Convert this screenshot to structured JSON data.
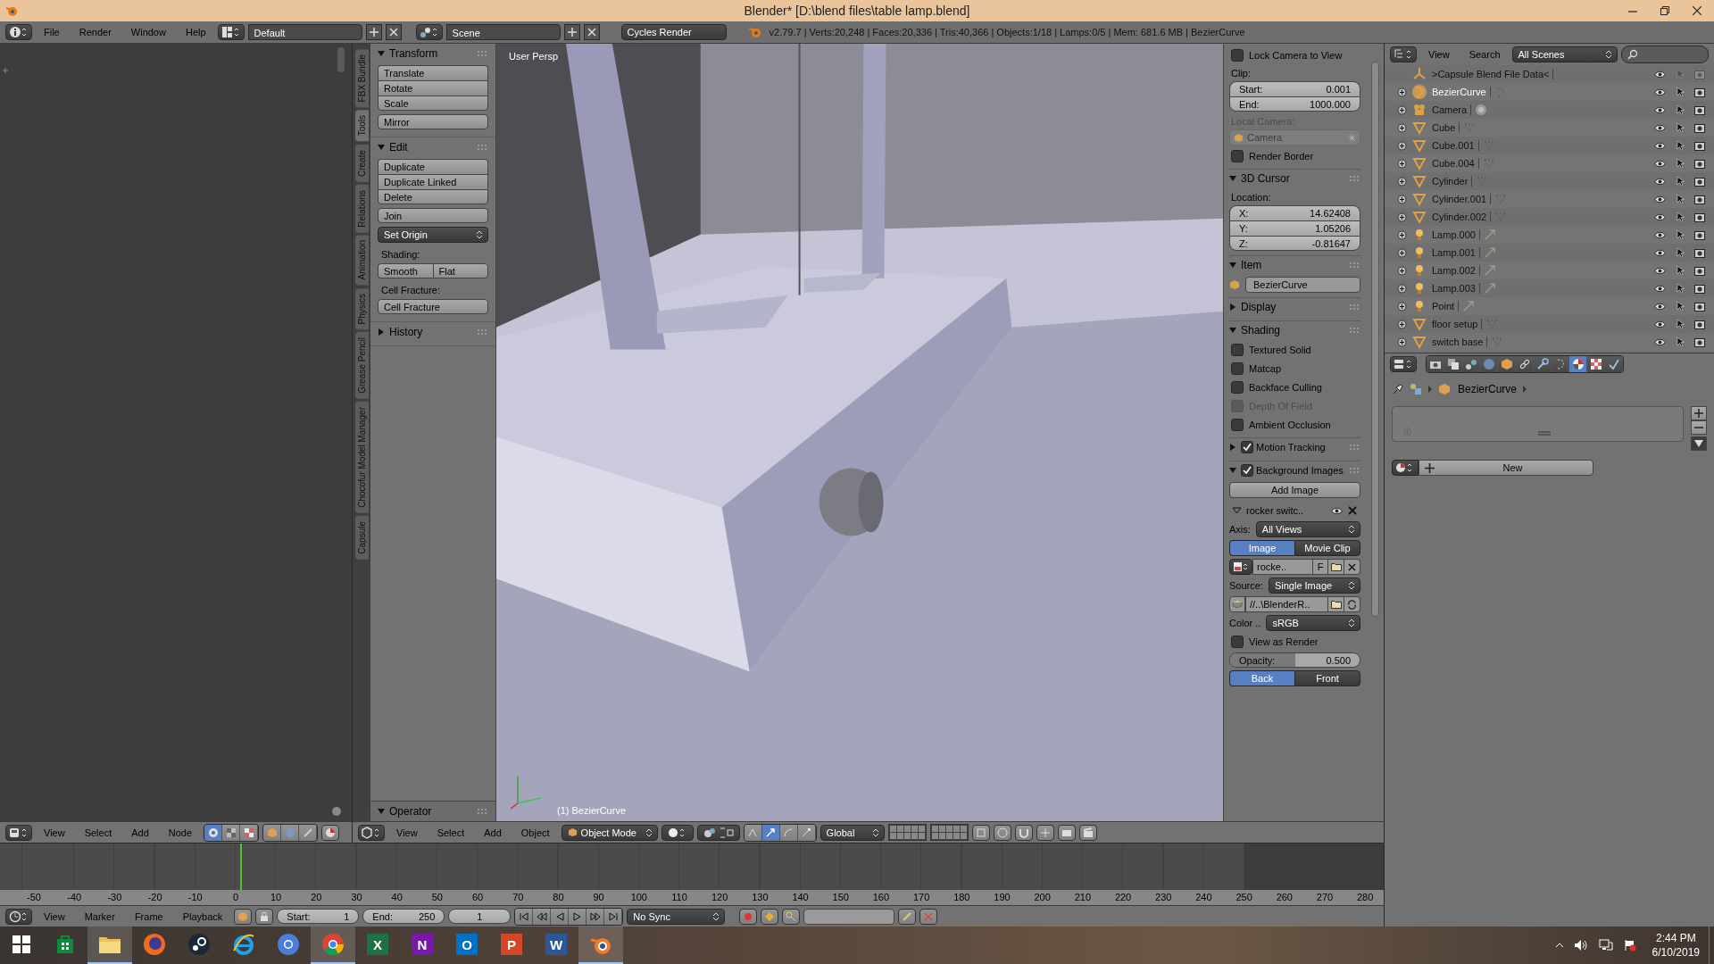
{
  "window": {
    "title": "Blender* [D:\\blend files\\table lamp.blend]"
  },
  "info_header": {
    "menus": [
      "File",
      "Render",
      "Window",
      "Help"
    ],
    "screen_layout": "Default",
    "scene": "Scene",
    "render_engine": "Cycles Render",
    "stats": "v2.79.7 | Verts:20,248 | Faces:20,336 | Tris:40,366 | Objects:1/18 | Lamps:0/5 | Mem: 681.6 MB | BezierCurve"
  },
  "node_editor": {
    "header_menus": [
      "View",
      "Select",
      "Add",
      "Node"
    ]
  },
  "tool_tabs": [
    {
      "label": "FBX Bundle",
      "selected": false
    },
    {
      "label": "Tools",
      "selected": true
    },
    {
      "label": "Create",
      "selected": false
    },
    {
      "label": "Relations",
      "selected": false
    },
    {
      "label": "Animation",
      "selected": false
    },
    {
      "label": "Physics",
      "selected": false
    },
    {
      "label": "Grease Pencil",
      "selected": false
    },
    {
      "label": "Chocofur Model Manager",
      "selected": false
    },
    {
      "label": "Capsule",
      "selected": false
    }
  ],
  "tool_shelf": [
    {
      "title": "Transform",
      "expanded": true,
      "items": [
        {
          "kind": "stack",
          "labels": [
            "Translate",
            "Rotate",
            "Scale"
          ]
        },
        {
          "kind": "stack",
          "labels": [
            "Mirror"
          ]
        }
      ]
    },
    {
      "title": "Edit",
      "expanded": true,
      "items": [
        {
          "kind": "stack",
          "labels": [
            "Duplicate",
            "Duplicate Linked",
            "Delete"
          ]
        },
        {
          "kind": "stack",
          "labels": [
            "Join"
          ]
        },
        {
          "kind": "dropdown",
          "label": "Set Origin"
        },
        {
          "kind": "label",
          "label": "Shading:"
        },
        {
          "kind": "row",
          "labels": [
            "Smooth",
            "Flat"
          ]
        },
        {
          "kind": "label",
          "label": "Cell Fracture:"
        },
        {
          "kind": "stack",
          "labels": [
            "Cell Fracture"
          ]
        }
      ]
    },
    {
      "title": "History",
      "expanded": false
    }
  ],
  "operator_panel": {
    "title": "Operator",
    "expanded": true
  },
  "viewport": {
    "view_name": "User Persp",
    "active_object": "(1) BezierCurve"
  },
  "viewport_header": {
    "menus": [
      "View",
      "Select",
      "Add",
      "Object"
    ],
    "mode": "Object Mode",
    "orientation": "Global"
  },
  "properties_region": [
    {
      "kind": "checkbox",
      "label": "Lock Camera to View",
      "checked": false,
      "disabled": false
    },
    {
      "kind": "label",
      "text": "Clip:",
      "disabled": false
    },
    {
      "kind": "number_group",
      "fields": [
        {
          "label": "Start:",
          "value": "0.001"
        },
        {
          "label": "End:",
          "value": "1000.000"
        }
      ]
    },
    {
      "kind": "label",
      "text": "Local Camera:",
      "disabled": true
    },
    {
      "kind": "object_field",
      "value": "Camera",
      "disabled": true
    },
    {
      "kind": "checkbox",
      "label": "Render Border",
      "checked": false,
      "disabled": false
    },
    {
      "kind": "section",
      "title": "3D Cursor",
      "expanded": true
    },
    {
      "kind": "label",
      "text": "Location:",
      "disabled": false
    },
    {
      "kind": "number_group",
      "fields": [
        {
          "label": "X:",
          "value": "14.62408"
        },
        {
          "label": "Y:",
          "value": "1.05206"
        },
        {
          "label": "Z:",
          "value": "-0.81647"
        }
      ]
    },
    {
      "kind": "section",
      "title": "Item",
      "expanded": true
    },
    {
      "kind": "name_field",
      "value": "BezierCurve"
    },
    {
      "kind": "section",
      "title": "Display",
      "expanded": false
    },
    {
      "kind": "section",
      "title": "Shading",
      "expanded": true
    },
    {
      "kind": "checkbox",
      "label": "Textured Solid",
      "checked": false,
      "disabled": false
    },
    {
      "kind": "checkbox",
      "label": "Matcap",
      "checked": false,
      "disabled": false
    },
    {
      "kind": "checkbox",
      "label": "Backface Culling",
      "checked": false,
      "disabled": false
    },
    {
      "kind": "checkbox",
      "label": "Depth Of Field",
      "checked": false,
      "disabled": true
    },
    {
      "kind": "checkbox",
      "label": "Ambient Occlusion",
      "checked": false,
      "disabled": false
    },
    {
      "kind": "section_toggle",
      "title": "Motion Tracking",
      "expanded": false,
      "checked": true
    },
    {
      "kind": "section_toggle",
      "title": "Background Images",
      "expanded": true,
      "checked": true
    },
    {
      "kind": "button",
      "label": "Add Image"
    },
    {
      "kind": "image_header",
      "label": "rocker switc..",
      "expanded": true
    },
    {
      "kind": "dropdown",
      "label": "Axis:",
      "value": "All Views"
    },
    {
      "kind": "toggle_pair",
      "options": [
        {
          "label": "Image",
          "selected": true
        },
        {
          "label": "Movie Clip",
          "selected": false
        }
      ]
    },
    {
      "kind": "file_row",
      "name": "rocke..",
      "flag": "F"
    },
    {
      "kind": "dropdown",
      "label": "Source:",
      "value": "Single Image"
    },
    {
      "kind": "path_field",
      "value": "//..\\BlenderR.."
    },
    {
      "kind": "dropdown",
      "label": "Color ..",
      "value": "sRGB"
    },
    {
      "kind": "checkbox",
      "label": "View as Render",
      "checked": false,
      "disabled": false
    },
    {
      "kind": "slider",
      "label": "Opacity:",
      "value": "0.500",
      "level": 0.5
    },
    {
      "kind": "toggle_pair",
      "options": [
        {
          "label": "Back",
          "selected": true
        },
        {
          "label": "Front",
          "selected": false
        }
      ]
    }
  ],
  "outliner": {
    "menus": [
      "View",
      "Search"
    ],
    "display": "All Scenes",
    "rows": [
      {
        "kind": "scene_root",
        "name": ">Capsule Blend File Data<",
        "active": false
      },
      {
        "kind": "curve",
        "name": "BezierCurve",
        "active": true
      },
      {
        "kind": "camera",
        "name": "Camera",
        "active": false
      },
      {
        "kind": "mesh",
        "name": "Cube",
        "active": false
      },
      {
        "kind": "mesh",
        "name": "Cube.001",
        "active": false
      },
      {
        "kind": "mesh",
        "name": "Cube.004",
        "active": false
      },
      {
        "kind": "mesh",
        "name": "Cylinder",
        "active": false
      },
      {
        "kind": "mesh",
        "name": "Cylinder.001",
        "active": false
      },
      {
        "kind": "mesh",
        "name": "Cylinder.002",
        "active": false
      },
      {
        "kind": "lamp",
        "name": "Lamp.000",
        "active": false
      },
      {
        "kind": "lamp",
        "name": "Lamp.001",
        "active": false
      },
      {
        "kind": "lamp",
        "name": "Lamp.002",
        "active": false
      },
      {
        "kind": "lamp",
        "name": "Lamp.003",
        "active": false
      },
      {
        "kind": "lamp",
        "name": "Point",
        "active": false
      },
      {
        "kind": "mesh",
        "name": "floor setup",
        "active": false
      },
      {
        "kind": "mesh",
        "name": "switch base",
        "active": false
      }
    ]
  },
  "properties_editor": {
    "tabs": [
      {
        "kind": "render",
        "selected": false
      },
      {
        "kind": "layers",
        "selected": false
      },
      {
        "kind": "scene",
        "selected": false
      },
      {
        "kind": "world",
        "selected": false
      },
      {
        "kind": "object",
        "selected": false
      },
      {
        "kind": "constraints",
        "selected": false
      },
      {
        "kind": "modifiers",
        "selected": false
      },
      {
        "kind": "data",
        "selected": false
      },
      {
        "kind": "material",
        "selected": true
      },
      {
        "kind": "texture",
        "selected": false
      },
      {
        "kind": "physics",
        "selected": false
      }
    ],
    "breadcrumb": "BezierCurve",
    "new_button": "New"
  },
  "timeline": {
    "ruler": [
      "-50",
      "-40",
      "-30",
      "-20",
      "-10",
      "0",
      "10",
      "20",
      "30",
      "40",
      "50",
      "60",
      "70",
      "80",
      "90",
      "100",
      "110",
      "120",
      "130",
      "140",
      "150",
      "160",
      "170",
      "180",
      "190",
      "200",
      "210",
      "220",
      "230",
      "240",
      "250",
      "260",
      "270",
      "280"
    ]
  },
  "timeline_header": {
    "menus": [
      "View",
      "Marker",
      "Frame",
      "Playback"
    ],
    "start_label": "Start:",
    "start": "1",
    "end_label": "End:",
    "end": "250",
    "current": "1",
    "sync": "No Sync"
  },
  "taskbar": {
    "apps": [
      {
        "kind": "store",
        "selected": false
      },
      {
        "kind": "folder",
        "selected": true
      },
      {
        "kind": "fox",
        "selected": false
      },
      {
        "kind": "steam",
        "selected": false
      },
      {
        "kind": "ie",
        "selected": false
      },
      {
        "kind": "chromium",
        "selected": false
      },
      {
        "kind": "chrome",
        "selected": true
      },
      {
        "kind": "tile",
        "glyph": "X",
        "color": "#1e7145",
        "selected": false
      },
      {
        "kind": "tile",
        "glyph": "N",
        "color": "#7719aa",
        "selected": false
      },
      {
        "kind": "tile",
        "glyph": "O",
        "color": "#0072c6",
        "selected": false
      },
      {
        "kind": "tile",
        "glyph": "P",
        "color": "#d24726",
        "selected": false
      },
      {
        "kind": "tile",
        "glyph": "W",
        "color": "#2b579a",
        "selected": false
      },
      {
        "kind": "blender",
        "selected": true
      }
    ],
    "time": "2:44 PM",
    "date": "6/10/2019"
  }
}
